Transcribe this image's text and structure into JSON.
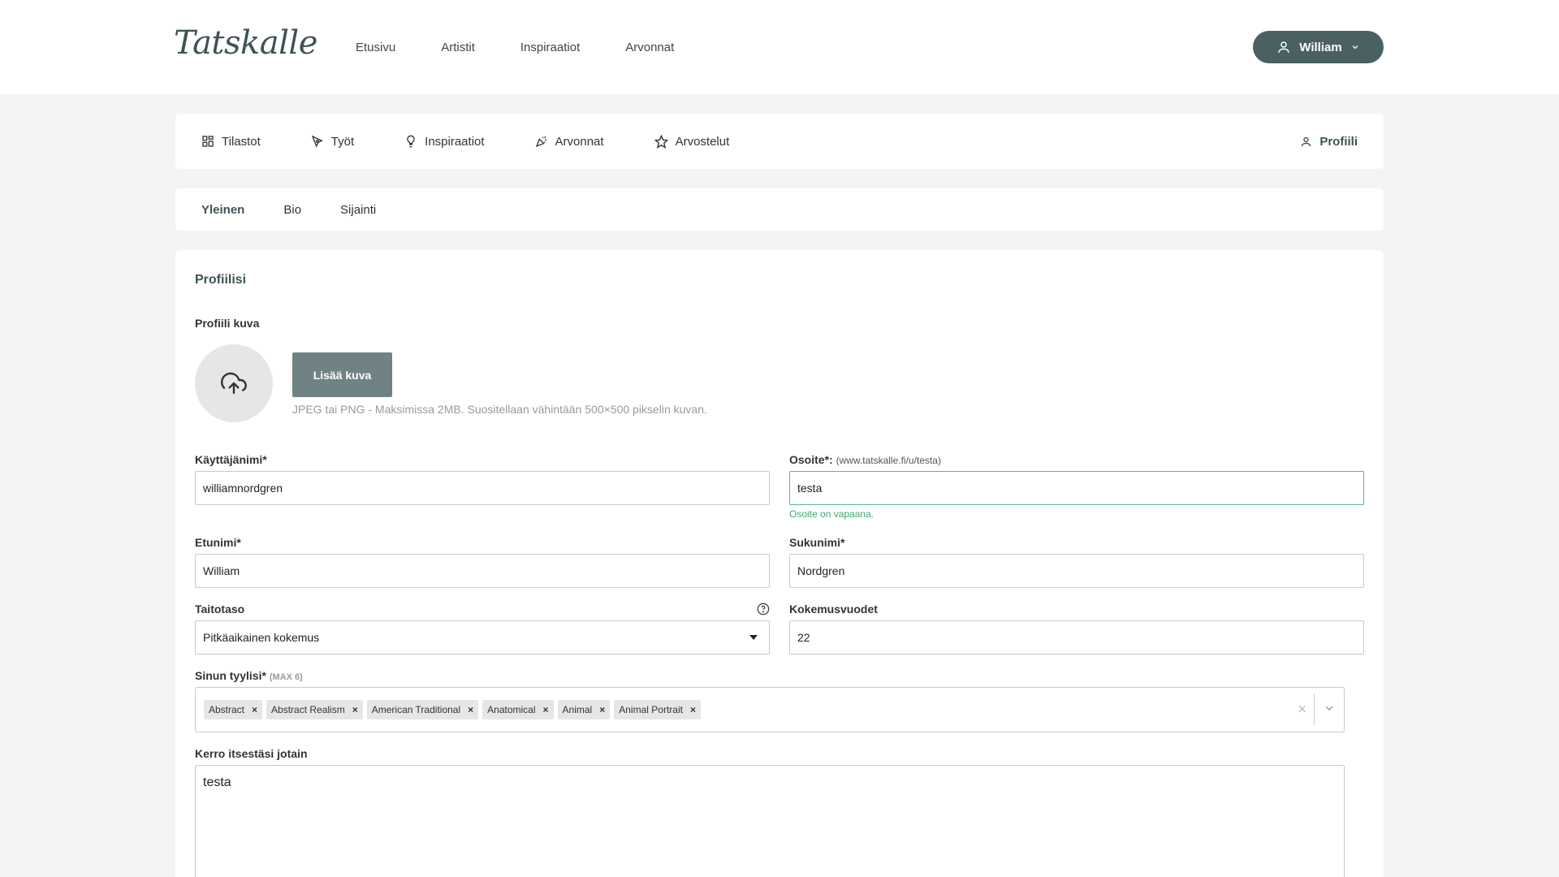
{
  "header": {
    "logo": "Tatskalle",
    "nav": [
      "Etusivu",
      "Artistit",
      "Inspiraatiot",
      "Arvonnat"
    ],
    "user_name": "William",
    "user_icon": "user-icon",
    "chevron_icon": "chevron-down-icon"
  },
  "dashboard_nav": {
    "items": [
      {
        "label": "Tilastot",
        "icon": "grid-icon"
      },
      {
        "label": "Työt",
        "icon": "pen-icon"
      },
      {
        "label": "Inspiraatiot",
        "icon": "lightbulb-icon"
      },
      {
        "label": "Arvonnat",
        "icon": "party-icon"
      },
      {
        "label": "Arvostelut",
        "icon": "star-icon"
      }
    ],
    "profile": "Profiili"
  },
  "tabs": [
    "Yleinen",
    "Bio",
    "Sijainti"
  ],
  "form": {
    "title": "Profiilisi",
    "image_label": "Profiili kuva",
    "add_image": "Lisää kuva",
    "image_hint": "JPEG tai PNG - Maksimissa 2MB. Suositellaan vähintään 500×500 pikselin kuvan.",
    "username_label": "Käyttäjänimi*",
    "username_value": "williamnordgren",
    "address_label": "Osoite*:",
    "address_hint": "(www.tatskalle.fi/u/testa)",
    "address_value": "testa",
    "address_ok": "Osoite on vapaana.",
    "firstname_label": "Etunimi*",
    "firstname_value": "William",
    "lastname_label": "Sukunimi*",
    "lastname_value": "Nordgren",
    "skill_label": "Taitotaso",
    "skill_value": "Pitkäaikainen kokemus",
    "experience_label": "Kokemusvuodet",
    "experience_value": "22",
    "styles_label": "Sinun tyylisi*",
    "styles_max": "(MAX 6)",
    "styles": [
      "Abstract",
      "Abstract Realism",
      "American Traditional",
      "Anatomical",
      "Animal",
      "Animal Portrait"
    ],
    "tag_remove": "×",
    "clear_symbol": "×",
    "about_label": "Kerro itsestäsi jotain",
    "about_value": "testa"
  }
}
